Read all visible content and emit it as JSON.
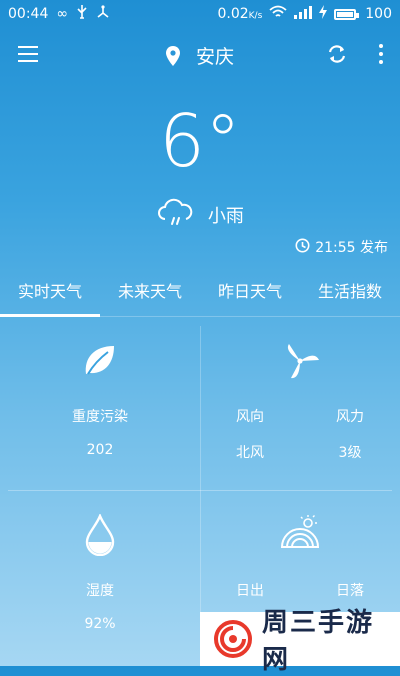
{
  "status": {
    "time": "00:44",
    "network_speed": "0.02",
    "speed_unit": "K/s",
    "battery": "100",
    "battery_level": 1.0
  },
  "header": {
    "city": "安庆",
    "icons": [
      "menu-icon",
      "location-pin-icon",
      "refresh-icon",
      "more-icon"
    ]
  },
  "current": {
    "temperature": "6°",
    "condition": "小雨",
    "condition_icon": "cloud-rain-icon",
    "publish_time": "21:55 发布"
  },
  "tabs": [
    {
      "label": "实时天气",
      "active": true
    },
    {
      "label": "未来天气",
      "active": false
    },
    {
      "label": "昨日天气",
      "active": false
    },
    {
      "label": "生活指数",
      "active": false
    }
  ],
  "cells": {
    "pollution": {
      "label": "重度污染",
      "value": "202",
      "icon": "leaf-icon"
    },
    "wind": {
      "direction_label": "风向",
      "direction_value": "北风",
      "force_label": "风力",
      "force_value": "3级",
      "icon": "windmill-icon"
    },
    "humidity": {
      "label": "湿度",
      "value": "92%",
      "icon": "water-drop-icon"
    },
    "sun": {
      "sunrise_label": "日出",
      "sunset_label": "日落",
      "icon": "sunrise-icon"
    }
  },
  "watermark": {
    "text": "周三手游网"
  },
  "colors": {
    "bg_top": "#1f8fd3",
    "bg_bottom": "#a6d7f3",
    "watermark_red": "#e8392b",
    "watermark_text": "#1a2a4a"
  }
}
